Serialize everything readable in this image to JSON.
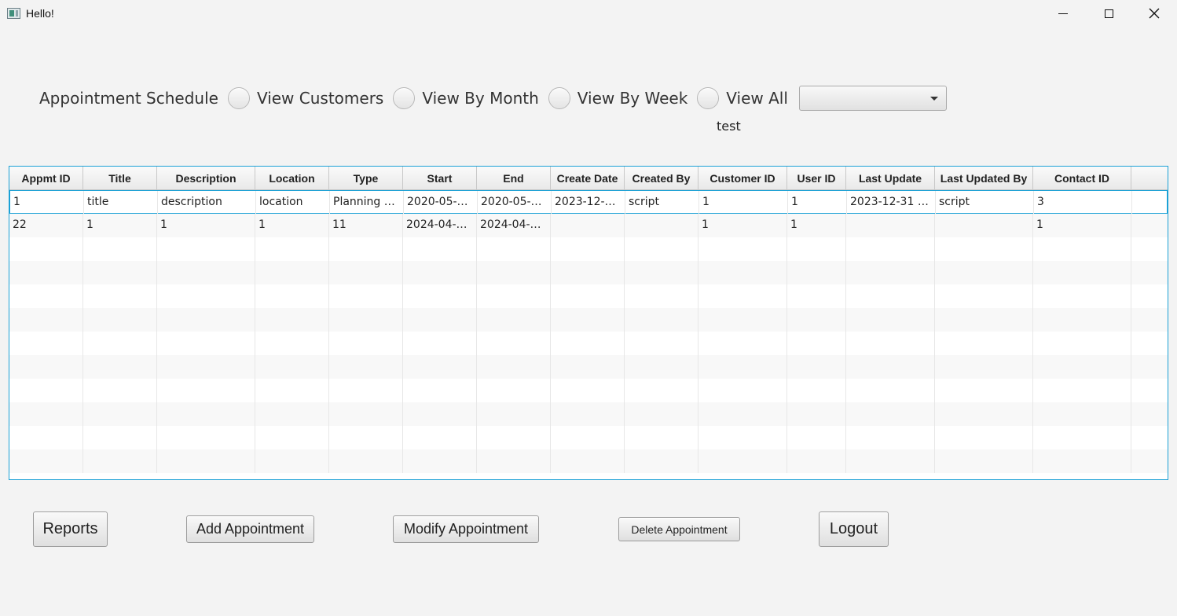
{
  "window": {
    "title": "Hello!",
    "controls": [
      "minimize-icon",
      "maximize-icon",
      "close-icon"
    ]
  },
  "filters": {
    "section_label": "Appointment Schedule",
    "radios": [
      {
        "label": "View Customers",
        "selected": false
      },
      {
        "label": "View By Month",
        "selected": false
      },
      {
        "label": "View By Week",
        "selected": false
      },
      {
        "label": "View All",
        "selected": false
      }
    ],
    "combo_value": "",
    "test_label": "test"
  },
  "table": {
    "columns": [
      "Appmt ID",
      "Title",
      "Description",
      "Location",
      "Type",
      "Start",
      "End",
      "Create Date",
      "Created By",
      "Customer ID",
      "User ID",
      "Last Update",
      "Last Updated By",
      "Contact ID"
    ],
    "rows": [
      [
        "1",
        "title",
        "description",
        "location",
        "Planning S...",
        "2020-05-2...",
        "2020-05-2...",
        "2023-12-3...",
        "script",
        "1",
        "1",
        "2023-12-31 1...",
        "script",
        "3"
      ],
      [
        "22",
        "1",
        "1",
        "1",
        "11",
        "2024-04-0...",
        "2024-04-1...",
        "",
        "",
        "1",
        "1",
        "",
        "",
        "1"
      ]
    ],
    "selected_row": 0
  },
  "buttons": {
    "reports": "Reports",
    "add": "Add Appointment",
    "modify": "Modify Appointment",
    "delete": "Delete Appointment",
    "logout": "Logout"
  },
  "colors": {
    "accent": "#1ba1d6",
    "background": "#f3f3f3"
  }
}
